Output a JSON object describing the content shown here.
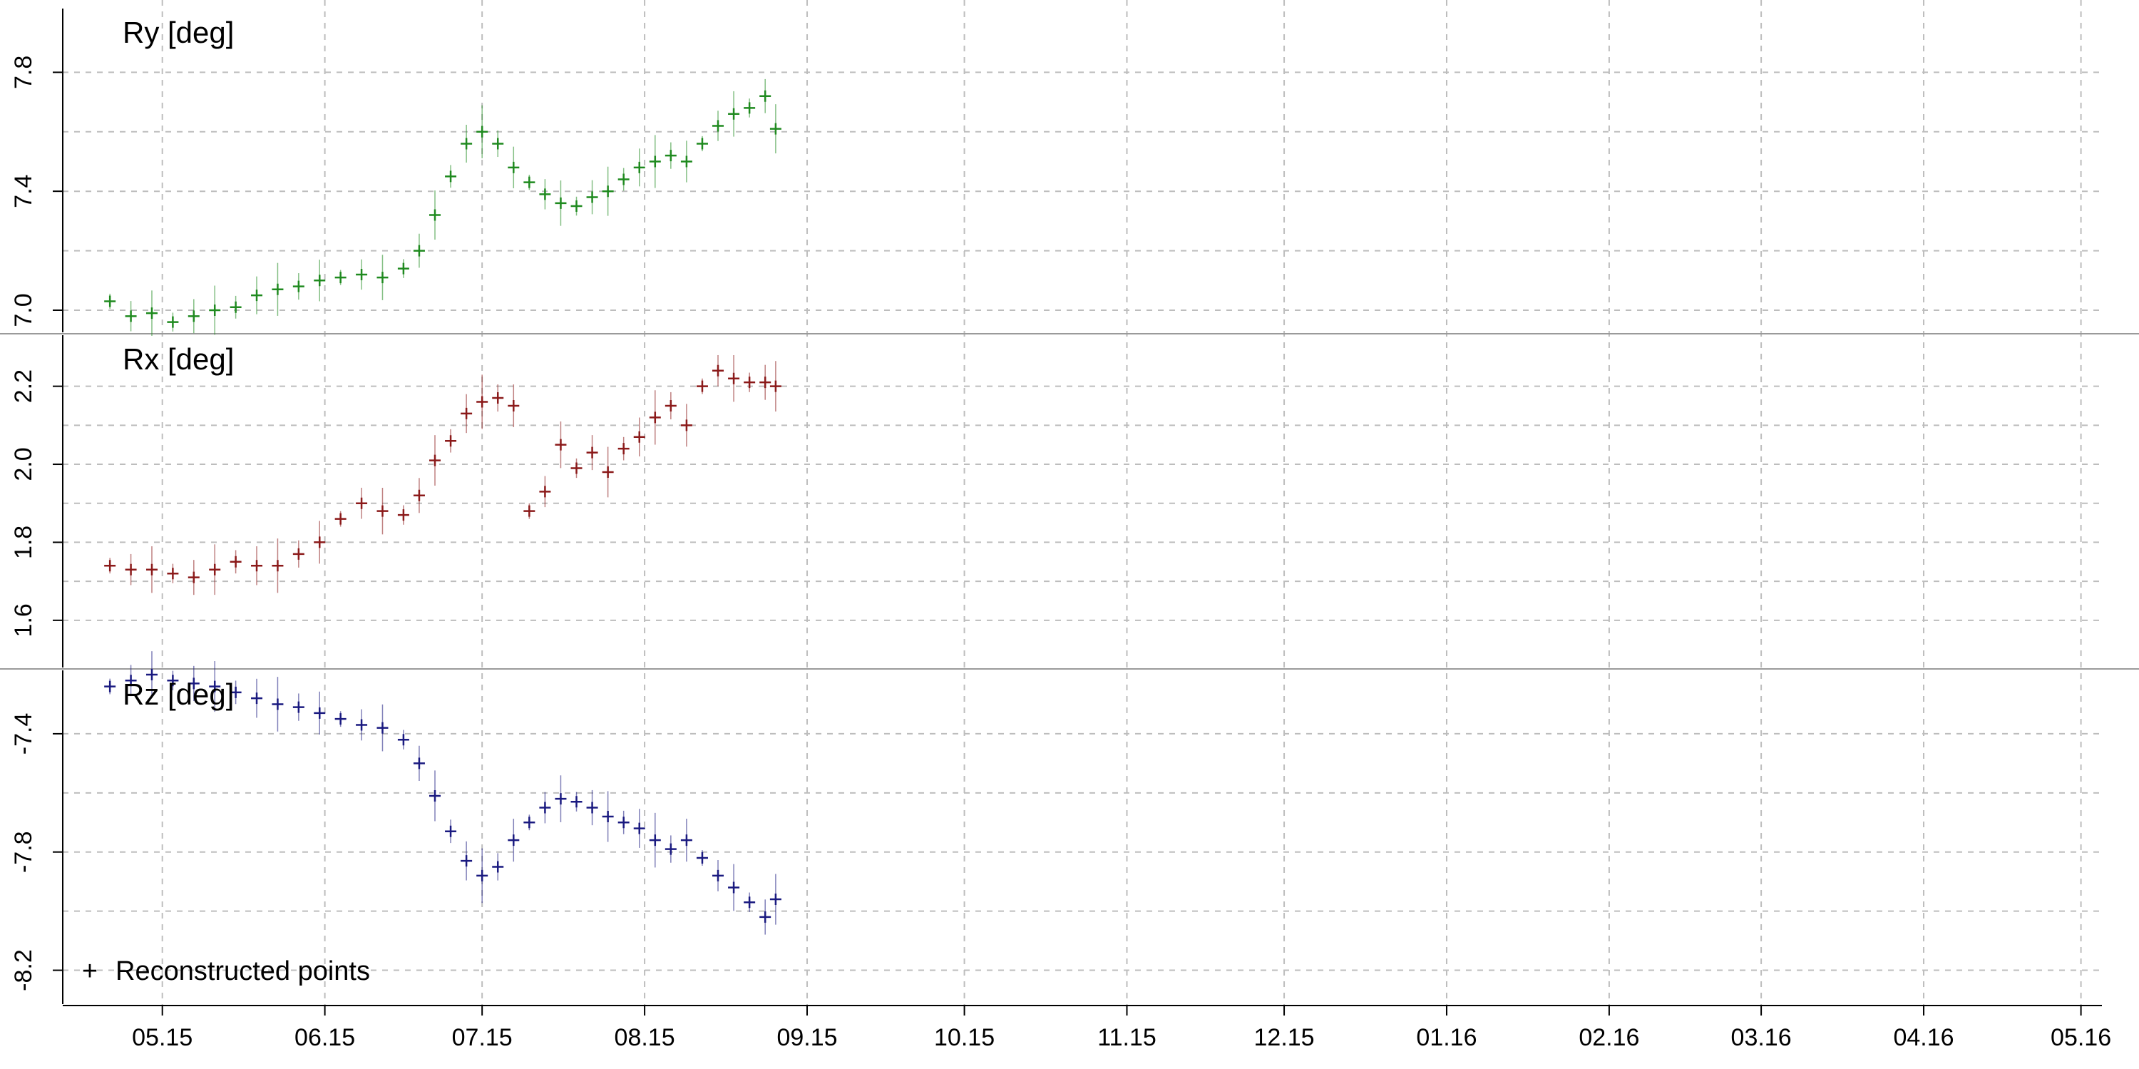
{
  "chart_data": {
    "type": "scatter",
    "x_axis": {
      "ticks": [
        {
          "date": "2015-05-15",
          "label": "05.15"
        },
        {
          "date": "2015-06-15",
          "label": "06.15"
        },
        {
          "date": "2015-07-15",
          "label": "07.15"
        },
        {
          "date": "2015-08-15",
          "label": "08.15"
        },
        {
          "date": "2015-09-15",
          "label": "09.15"
        },
        {
          "date": "2015-10-15",
          "label": "10.15"
        },
        {
          "date": "2015-11-15",
          "label": "11.15"
        },
        {
          "date": "2015-12-15",
          "label": "12.15"
        },
        {
          "date": "2016-01-15",
          "label": "01.16"
        },
        {
          "date": "2016-02-15",
          "label": "02.16"
        },
        {
          "date": "2016-03-15",
          "label": "03.16"
        },
        {
          "date": "2016-04-15",
          "label": "04.16"
        },
        {
          "date": "2016-05-15",
          "label": "05.16"
        }
      ],
      "range": [
        "2015-04-26",
        "2016-05-19"
      ],
      "grid": true
    },
    "panels": [
      {
        "label": "Ry  [deg]",
        "color": "#1f8a1f",
        "ylim": [
          6.94,
          8.0
        ],
        "yticks": [
          7.0,
          7.4,
          7.8
        ],
        "ytick_labels": [
          "7.0",
          "7.4",
          "7.8"
        ],
        "points": [
          [
            "2015-05-05",
            7.03
          ],
          [
            "2015-05-09",
            6.98
          ],
          [
            "2015-05-13",
            6.99
          ],
          [
            "2015-05-17",
            6.96
          ],
          [
            "2015-05-21",
            6.98
          ],
          [
            "2015-05-25",
            7.0
          ],
          [
            "2015-05-29",
            7.01
          ],
          [
            "2015-06-02",
            7.05
          ],
          [
            "2015-06-06",
            7.07
          ],
          [
            "2015-06-10",
            7.08
          ],
          [
            "2015-06-14",
            7.1
          ],
          [
            "2015-06-18",
            7.11
          ],
          [
            "2015-06-22",
            7.12
          ],
          [
            "2015-06-26",
            7.11
          ],
          [
            "2015-06-30",
            7.14
          ],
          [
            "2015-07-03",
            7.2
          ],
          [
            "2015-07-06",
            7.32
          ],
          [
            "2015-07-09",
            7.45
          ],
          [
            "2015-07-12",
            7.56
          ],
          [
            "2015-07-15",
            7.6
          ],
          [
            "2015-07-18",
            7.56
          ],
          [
            "2015-07-21",
            7.48
          ],
          [
            "2015-07-24",
            7.43
          ],
          [
            "2015-07-27",
            7.39
          ],
          [
            "2015-07-30",
            7.36
          ],
          [
            "2015-08-02",
            7.35
          ],
          [
            "2015-08-05",
            7.38
          ],
          [
            "2015-08-08",
            7.4
          ],
          [
            "2015-08-11",
            7.44
          ],
          [
            "2015-08-14",
            7.48
          ],
          [
            "2015-08-17",
            7.5
          ],
          [
            "2015-08-20",
            7.52
          ],
          [
            "2015-08-23",
            7.5
          ],
          [
            "2015-08-26",
            7.56
          ],
          [
            "2015-08-29",
            7.62
          ],
          [
            "2015-09-01",
            7.66
          ],
          [
            "2015-09-04",
            7.68
          ],
          [
            "2015-09-07",
            7.72
          ],
          [
            "2015-09-09",
            7.61
          ]
        ]
      },
      {
        "label": "Rx  [deg]",
        "color": "#8b1a1a",
        "ylim": [
          1.49,
          2.32
        ],
        "yticks": [
          1.6,
          1.8,
          2.0,
          2.2
        ],
        "ytick_labels": [
          "1.6",
          "1.8",
          "2.0",
          "2.2"
        ],
        "points": [
          [
            "2015-05-05",
            1.74
          ],
          [
            "2015-05-09",
            1.73
          ],
          [
            "2015-05-13",
            1.73
          ],
          [
            "2015-05-17",
            1.72
          ],
          [
            "2015-05-21",
            1.71
          ],
          [
            "2015-05-25",
            1.73
          ],
          [
            "2015-05-29",
            1.75
          ],
          [
            "2015-06-02",
            1.74
          ],
          [
            "2015-06-06",
            1.74
          ],
          [
            "2015-06-10",
            1.77
          ],
          [
            "2015-06-14",
            1.8
          ],
          [
            "2015-06-18",
            1.86
          ],
          [
            "2015-06-22",
            1.9
          ],
          [
            "2015-06-26",
            1.88
          ],
          [
            "2015-06-30",
            1.87
          ],
          [
            "2015-07-03",
            1.92
          ],
          [
            "2015-07-06",
            2.01
          ],
          [
            "2015-07-09",
            2.06
          ],
          [
            "2015-07-12",
            2.13
          ],
          [
            "2015-07-15",
            2.16
          ],
          [
            "2015-07-18",
            2.17
          ],
          [
            "2015-07-21",
            2.15
          ],
          [
            "2015-07-24",
            1.88
          ],
          [
            "2015-07-27",
            1.93
          ],
          [
            "2015-07-30",
            2.05
          ],
          [
            "2015-08-02",
            1.99
          ],
          [
            "2015-08-05",
            2.03
          ],
          [
            "2015-08-08",
            1.98
          ],
          [
            "2015-08-11",
            2.04
          ],
          [
            "2015-08-14",
            2.07
          ],
          [
            "2015-08-17",
            2.12
          ],
          [
            "2015-08-20",
            2.15
          ],
          [
            "2015-08-23",
            2.1
          ],
          [
            "2015-08-26",
            2.2
          ],
          [
            "2015-08-29",
            2.24
          ],
          [
            "2015-09-01",
            2.22
          ],
          [
            "2015-09-04",
            2.21
          ],
          [
            "2015-09-07",
            2.21
          ],
          [
            "2015-09-09",
            2.2
          ]
        ]
      },
      {
        "label": "Rz  [deg]",
        "color": "#1a1a80",
        "ylim": [
          -8.3,
          -7.2
        ],
        "yticks": [
          -8.2,
          -7.8,
          -7.4
        ],
        "ytick_labels": [
          "-8.2",
          "-7.8",
          "-7.4"
        ],
        "points": [
          [
            "2015-05-05",
            -7.24
          ],
          [
            "2015-05-09",
            -7.22
          ],
          [
            "2015-05-13",
            -7.2
          ],
          [
            "2015-05-17",
            -7.22
          ],
          [
            "2015-05-21",
            -7.23
          ],
          [
            "2015-05-25",
            -7.24
          ],
          [
            "2015-05-29",
            -7.26
          ],
          [
            "2015-06-02",
            -7.28
          ],
          [
            "2015-06-06",
            -7.3
          ],
          [
            "2015-06-10",
            -7.31
          ],
          [
            "2015-06-14",
            -7.33
          ],
          [
            "2015-06-18",
            -7.35
          ],
          [
            "2015-06-22",
            -7.37
          ],
          [
            "2015-06-26",
            -7.38
          ],
          [
            "2015-06-30",
            -7.42
          ],
          [
            "2015-07-03",
            -7.5
          ],
          [
            "2015-07-06",
            -7.61
          ],
          [
            "2015-07-09",
            -7.73
          ],
          [
            "2015-07-12",
            -7.83
          ],
          [
            "2015-07-15",
            -7.88
          ],
          [
            "2015-07-18",
            -7.85
          ],
          [
            "2015-07-21",
            -7.76
          ],
          [
            "2015-07-24",
            -7.7
          ],
          [
            "2015-07-27",
            -7.65
          ],
          [
            "2015-07-30",
            -7.62
          ],
          [
            "2015-08-02",
            -7.63
          ],
          [
            "2015-08-05",
            -7.65
          ],
          [
            "2015-08-08",
            -7.68
          ],
          [
            "2015-08-11",
            -7.7
          ],
          [
            "2015-08-14",
            -7.72
          ],
          [
            "2015-08-17",
            -7.76
          ],
          [
            "2015-08-20",
            -7.79
          ],
          [
            "2015-08-23",
            -7.76
          ],
          [
            "2015-08-26",
            -7.82
          ],
          [
            "2015-08-29",
            -7.88
          ],
          [
            "2015-09-01",
            -7.92
          ],
          [
            "2015-09-04",
            -7.97
          ],
          [
            "2015-09-07",
            -8.02
          ],
          [
            "2015-09-09",
            -7.96
          ]
        ]
      }
    ],
    "legend": {
      "marker": "+",
      "label": "Reconstructed points",
      "position": "bottom-left"
    }
  }
}
